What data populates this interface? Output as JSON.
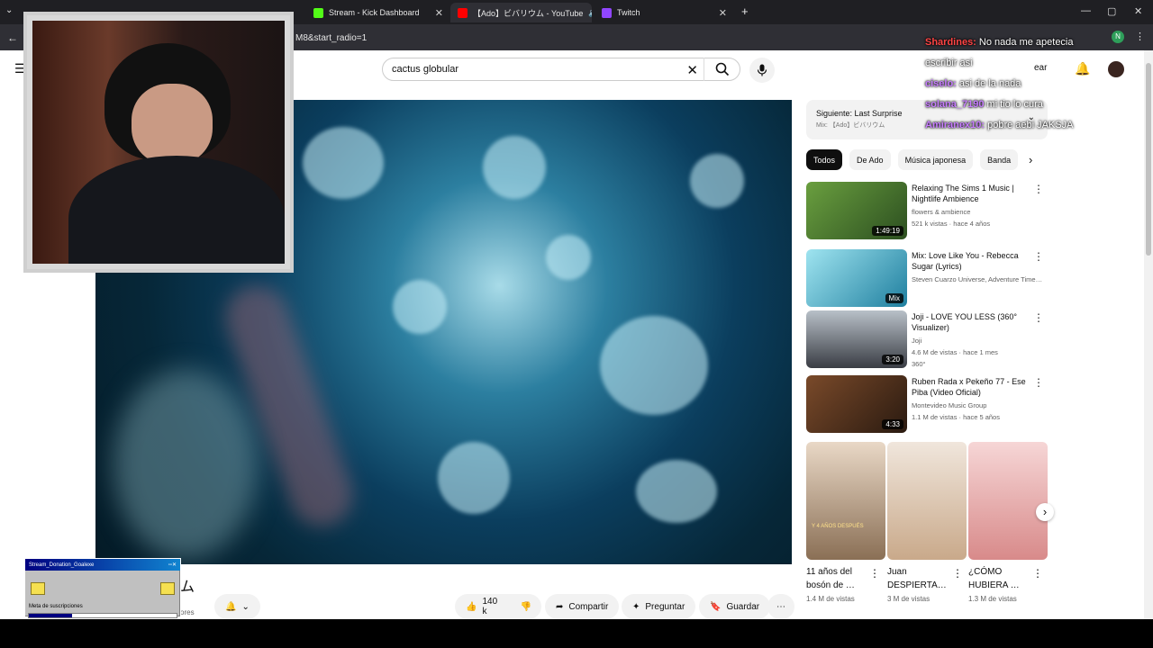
{
  "browser": {
    "tabs": [
      {
        "label": "Stream - Kick Dashboard",
        "color": "#53fc18"
      },
      {
        "label": "【Ado】ビバリウム - YouTube",
        "color": "#ff0000"
      },
      {
        "label": "Twitch",
        "color": "#9146ff"
      }
    ],
    "address": "M8&start_radio=1"
  },
  "youtube": {
    "search_value": "cactus globular",
    "create_label": "ear",
    "video_title": "ム",
    "subscribers_partial": "ores",
    "like_count": "140 k",
    "share_label": "Compartir",
    "ask_label": "Preguntar",
    "save_label": "Guardar",
    "up_next_label": "Siguiente: Last Surprise",
    "up_next_sub": "Mix: 【Ado】ビバリウム",
    "chips": [
      "Todos",
      "De Ado",
      "Música japonesa",
      "Banda"
    ],
    "recommendations": [
      {
        "title": "Relaxing The Sims 1 Music | Nightlife Ambience",
        "meta1": "flowers & ambience",
        "meta2": "521 k vistas · hace 4 años",
        "duration": "1:49:19",
        "color": "#3d6b2f"
      },
      {
        "title": "Mix: Love Like You - Rebecca Sugar (Lyrics)",
        "meta1": "Steven Cuarzo Universe, Adventure Time…",
        "meta2": "",
        "duration": "Mix",
        "color": "#2a9fb8"
      },
      {
        "title": "Joji - LOVE YOU LESS (360° Visualizer)",
        "meta1": "Joji",
        "meta2": "4.6 M de vistas · hace 1 mes",
        "meta3": "360°",
        "duration": "3:20",
        "color": "#4a4d55"
      },
      {
        "title": "Ruben Rada x Pekeño 77 - Ese Piba (Video Oficial)",
        "meta1": "Montevideo Music Group",
        "meta2": "1.1 M de vistas · hace 5 años",
        "duration": "4:33",
        "color": "#5a3520"
      }
    ],
    "shorts": [
      {
        "title": "11 años del bosón de …",
        "views": "1.4 M de vistas",
        "caption": "Y 4 AÑOS DESPUÉS",
        "color": "#8a6f55"
      },
      {
        "title": "Juan DESPIERTA…",
        "views": "3 M de vistas",
        "caption": "",
        "color": "#c9a98a"
      },
      {
        "title": "¿CÓMO HUBIERA …",
        "views": "1.3 M de vistas",
        "caption": "",
        "color": "#d88a8a"
      }
    ]
  },
  "chat": [
    {
      "user": "Shardines:",
      "text": "No nada me apetecia",
      "color": "#ff4444"
    },
    {
      "user": "",
      "text": "escribir asi",
      "color": "#ffffff"
    },
    {
      "user": "ciselo:",
      "text": "asi de la nada",
      "color": "#c77dff"
    },
    {
      "user": "solana_7190",
      "text": "mi tio lo cura",
      "color": "#c77dff"
    },
    {
      "user": "Amiranex10:",
      "text": "pobre aebi JAKSJA",
      "color": "#c77dff"
    }
  ],
  "goal": {
    "title": "Stream_Donation_Goalexe",
    "label": "Meta de suscripciones",
    "progress": 0.29
  }
}
